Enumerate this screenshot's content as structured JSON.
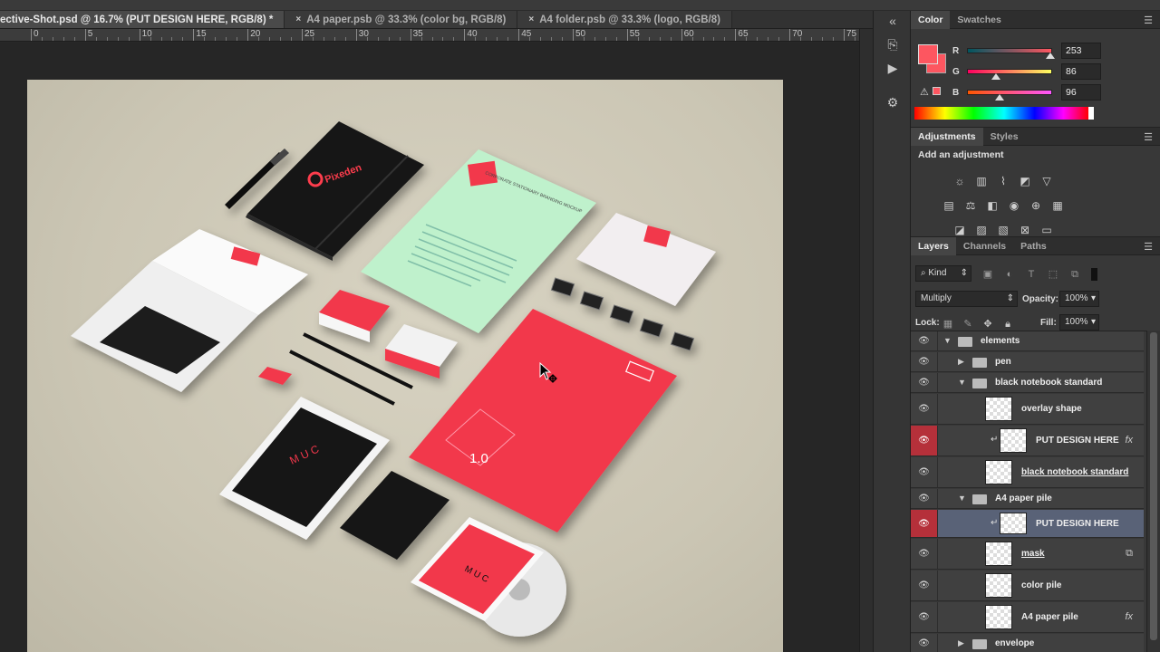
{
  "tabs": [
    {
      "label": "ective-Shot.psd @ 16.7% (PUT DESIGN HERE, RGB/8) *",
      "close": "",
      "active": true
    },
    {
      "label": "A4 paper.psb @ 33.3% (color bg, RGB/8)",
      "close": "×",
      "active": false
    },
    {
      "label": "A4 folder.psb @ 33.3% (logo, RGB/8)",
      "close": "×",
      "active": false
    }
  ],
  "ruler": {
    "labels": [
      "0",
      "5",
      "10",
      "15",
      "20",
      "25",
      "30",
      "35",
      "40",
      "45",
      "50",
      "55",
      "60",
      "65",
      "70",
      "75"
    ]
  },
  "colors": {
    "accent": "#fd5660",
    "selected_layer": "#596277",
    "visibility_red": "#b5303a"
  },
  "color_panel": {
    "tabs": [
      "Color",
      "Swatches"
    ],
    "channels": [
      {
        "label": "R",
        "value": "253",
        "fraction": 0.992
      },
      {
        "label": "G",
        "value": "86",
        "fraction": 0.337
      },
      {
        "label": "B",
        "value": "96",
        "fraction": 0.376
      }
    ],
    "foreground": "#fd5660"
  },
  "adjustments_panel": {
    "tabs": [
      "Adjustments",
      "Styles"
    ],
    "title": "Add an adjustment",
    "icons": [
      [
        "brightness-contrast-icon",
        "levels-icon",
        "curves-icon",
        "exposure-icon",
        "vibrance-icon"
      ],
      [
        "hue-saturation-icon",
        "color-balance-icon",
        "black-white-icon",
        "photo-filter-icon",
        "channel-mixer-icon",
        "color-lookup-icon"
      ],
      [
        "invert-icon",
        "posterize-icon",
        "threshold-icon",
        "selective-color-icon",
        "gradient-map-icon"
      ]
    ]
  },
  "layers_panel": {
    "tabs": [
      "Layers",
      "Channels",
      "Paths"
    ],
    "filter_kind": "Kind",
    "blend_mode": "Multiply",
    "opacity_label": "Opacity:",
    "opacity": "100%",
    "lock_label": "Lock:",
    "fill_label": "Fill:",
    "fill": "100%",
    "layers": [
      {
        "name": "elements",
        "type": "group",
        "indent": 0,
        "expanded": true,
        "visible": true
      },
      {
        "name": "pen",
        "type": "group",
        "indent": 1,
        "expanded": false,
        "visible": true
      },
      {
        "name": "black notebook standard",
        "type": "group",
        "indent": 1,
        "expanded": true,
        "visible": true
      },
      {
        "name": "overlay shape",
        "type": "layer",
        "indent": 2,
        "visible": true
      },
      {
        "name": "PUT DESIGN HERE",
        "type": "smart",
        "indent": 2,
        "clipped": true,
        "fx": true,
        "visible": true,
        "red_eye": true
      },
      {
        "name": "black notebook standard",
        "type": "layer",
        "indent": 2,
        "visible": true,
        "underlined": true
      },
      {
        "name": "A4 paper pile",
        "type": "group",
        "indent": 1,
        "expanded": true,
        "visible": true
      },
      {
        "name": "PUT DESIGN HERE",
        "type": "smart",
        "indent": 2,
        "clipped": true,
        "visible": true,
        "red_eye": true,
        "selected": true
      },
      {
        "name": "mask",
        "type": "layer",
        "indent": 2,
        "visible": true,
        "underlined": true,
        "linked": true
      },
      {
        "name": "color pile",
        "type": "layer",
        "indent": 2,
        "visible": true
      },
      {
        "name": "A4 paper pile",
        "type": "layer",
        "indent": 2,
        "visible": true,
        "fx": true
      },
      {
        "name": "envelope",
        "type": "group",
        "indent": 1,
        "expanded": false,
        "visible": true
      }
    ]
  },
  "mockup": {
    "notebook_brand": "Pixeden",
    "logo_text": "M U C",
    "version_text": "1.0",
    "letter_header": "CORPORATE STATIONARY BRANDING MOCKUP"
  }
}
